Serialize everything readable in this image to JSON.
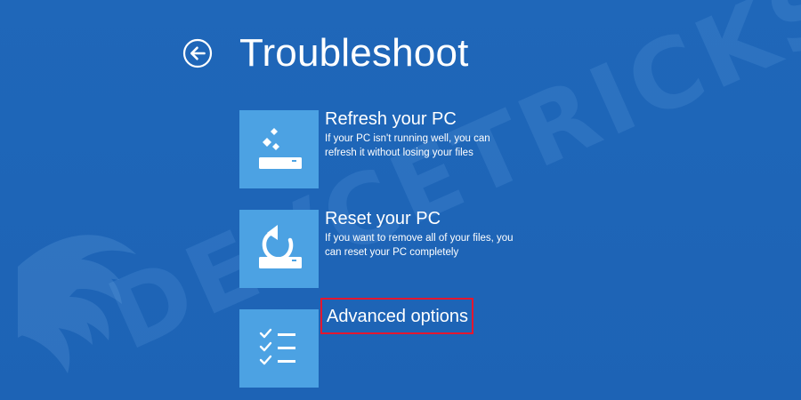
{
  "header": {
    "title": "Troubleshoot"
  },
  "watermark": {
    "text": "DEVCETRICKS"
  },
  "options": [
    {
      "title": "Refresh your PC",
      "description": "If your PC isn't running well, you can refresh it without losing your files",
      "icon": "refresh-pc-icon"
    },
    {
      "title": "Reset your PC",
      "description": "If you want to remove all of your files, you can reset your PC completely",
      "icon": "reset-pc-icon"
    },
    {
      "title": "Advanced options",
      "description": "",
      "icon": "advanced-options-checklist-icon"
    }
  ],
  "colors": {
    "background": "#1f65b8",
    "tile": "#4ca2e3",
    "text": "#ffffff",
    "highlight": "#e4172f"
  }
}
